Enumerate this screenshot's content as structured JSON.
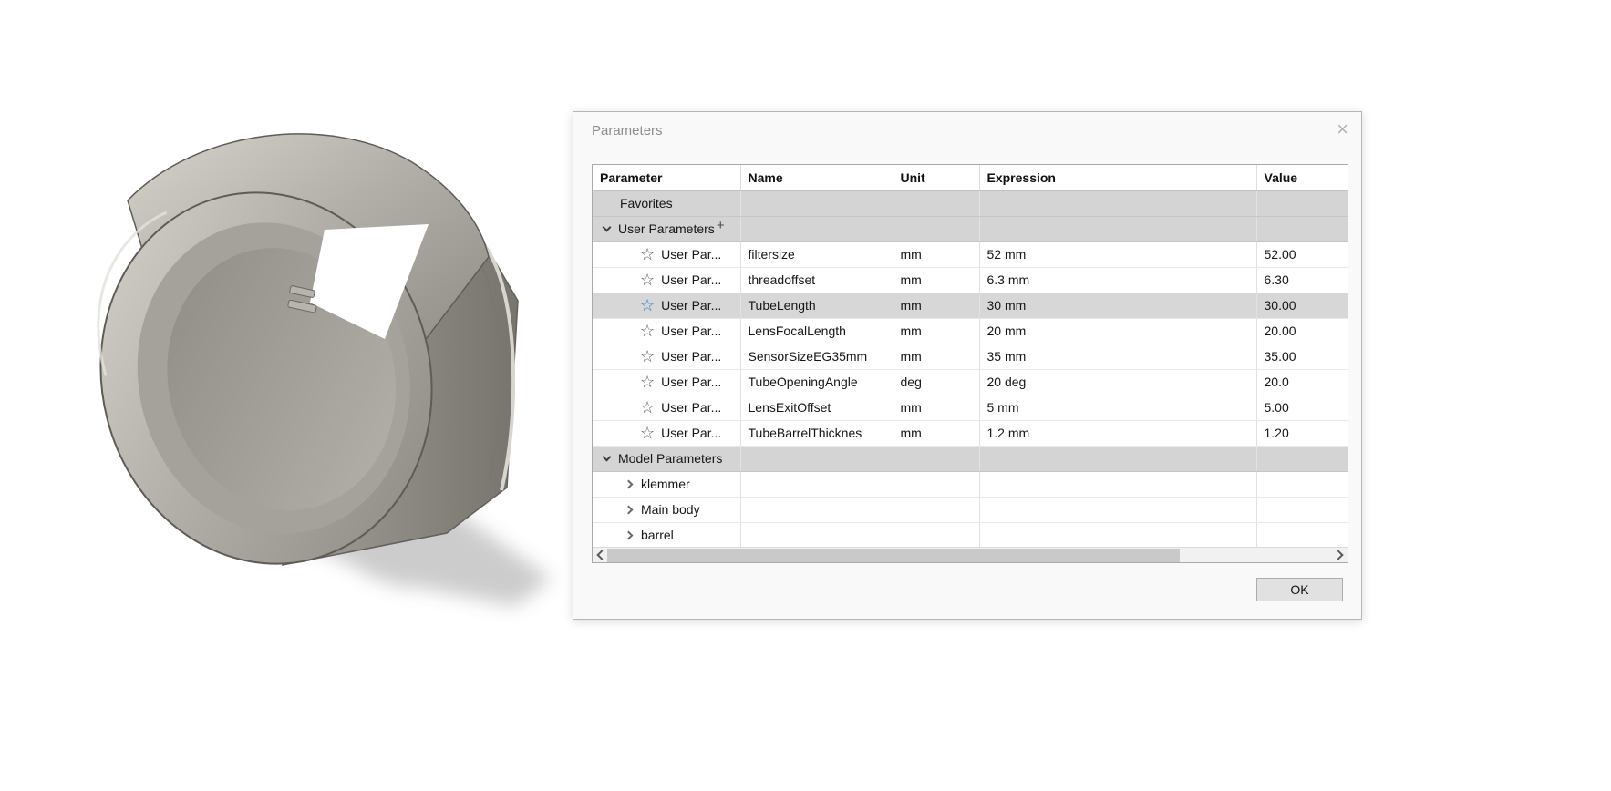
{
  "viewport": {
    "model_icon": "lens-hood-3d-model"
  },
  "dialog": {
    "title": "Parameters",
    "close_icon": "×",
    "ok_label": "OK",
    "columns": [
      "Parameter",
      "Name",
      "Unit",
      "Expression",
      "Value"
    ],
    "rows": [
      {
        "kind": "section",
        "label": "Favorites"
      },
      {
        "kind": "group",
        "label": "User Parameters",
        "plus": "+"
      },
      {
        "kind": "param",
        "favorite_icon": "star-icon",
        "param_label": "User Par...",
        "name": "filtersize",
        "unit": "mm",
        "expression": "52 mm",
        "value": "52.00",
        "selected": false
      },
      {
        "kind": "param",
        "favorite_icon": "star-icon",
        "param_label": "User Par...",
        "name": "threadoffset",
        "unit": "mm",
        "expression": "6.3 mm",
        "value": "6.30",
        "selected": false
      },
      {
        "kind": "param",
        "favorite_icon": "star-icon",
        "param_label": "User Par...",
        "name": "TubeLength",
        "unit": "mm",
        "expression": "30 mm",
        "value": "30.00",
        "selected": true
      },
      {
        "kind": "param",
        "favorite_icon": "star-icon",
        "param_label": "User Par...",
        "name": "LensFocalLength",
        "unit": "mm",
        "expression": "20 mm",
        "value": "20.00",
        "selected": false
      },
      {
        "kind": "param",
        "favorite_icon": "star-icon",
        "param_label": "User Par...",
        "name": "SensorSizeEG35mm",
        "unit": "mm",
        "expression": "35 mm",
        "value": "35.00",
        "selected": false
      },
      {
        "kind": "param",
        "favorite_icon": "star-icon",
        "param_label": "User Par...",
        "name": "TubeOpeningAngle",
        "unit": "deg",
        "expression": "20 deg",
        "value": "20.0",
        "selected": false
      },
      {
        "kind": "param",
        "favorite_icon": "star-icon",
        "param_label": "User Par...",
        "name": "LensExitOffset",
        "unit": "mm",
        "expression": "5 mm",
        "value": "5.00",
        "selected": false
      },
      {
        "kind": "param",
        "favorite_icon": "star-icon",
        "param_label": "User Par...",
        "name": "TubeBarrelThicknes",
        "unit": "mm",
        "expression": "1.2 mm",
        "value": "1.20",
        "selected": false
      },
      {
        "kind": "group",
        "label": "Model Parameters"
      },
      {
        "kind": "child",
        "label": "klemmer"
      },
      {
        "kind": "child",
        "label": "Main body"
      },
      {
        "kind": "child",
        "label": "barrel"
      }
    ]
  }
}
